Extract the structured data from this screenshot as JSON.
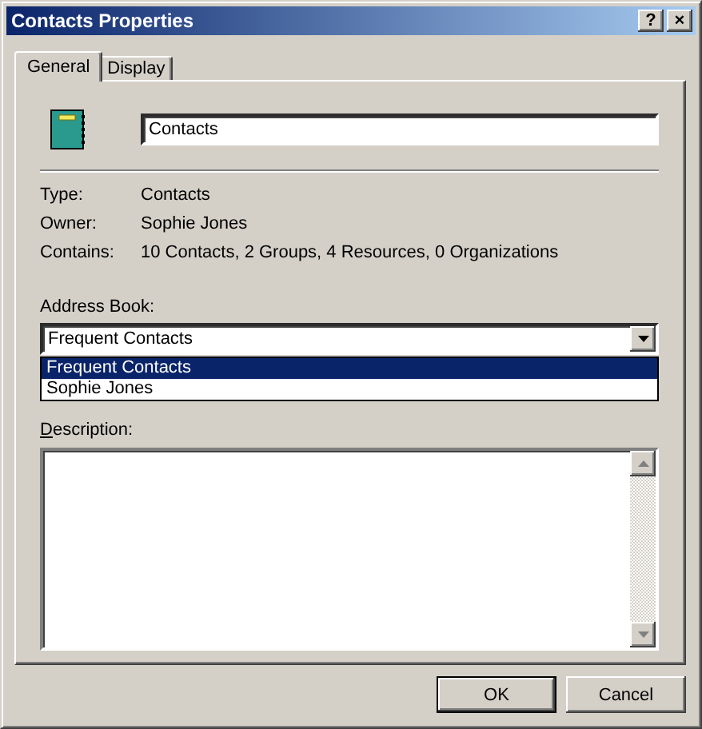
{
  "window": {
    "title": "Contacts Properties",
    "title_buttons": [
      "?",
      "×"
    ]
  },
  "tabs": [
    {
      "label": "General",
      "selected": true
    },
    {
      "label": "Display",
      "selected": false
    }
  ],
  "name_field": {
    "value": "Contacts"
  },
  "info": [
    {
      "label": "Type:",
      "value": "Contacts"
    },
    {
      "label": "Owner:",
      "value": "Sophie Jones"
    },
    {
      "label": "Contains:",
      "value": "10 Contacts, 2 Groups, 4 Resources, 0 Organizations"
    }
  ],
  "address_book": {
    "label": "Address Book:",
    "value": "Frequent Contacts",
    "expanded": true,
    "options": [
      {
        "label": "Frequent Contacts",
        "selected": true
      },
      {
        "label": "Sophie Jones",
        "selected": false
      }
    ]
  },
  "description": {
    "label": "Description:"
  },
  "buttons": [
    {
      "label": "OK",
      "default": true
    },
    {
      "label": "Cancel",
      "default": false
    }
  ]
}
